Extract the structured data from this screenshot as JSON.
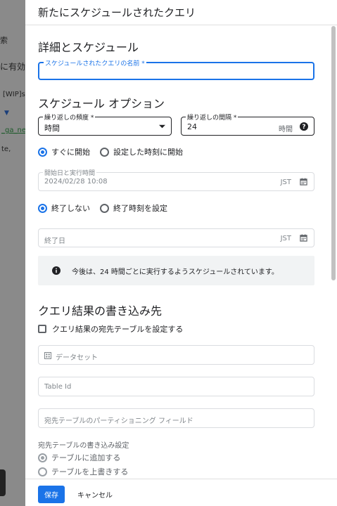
{
  "background": {
    "fragment_search": "索",
    "fragment_enabled": "に有効",
    "fragment_wip": "[WIP]si",
    "fragment_link": "_ga_new",
    "fragment_text": "te,"
  },
  "panel": {
    "title": "新たにスケジュールされたクエリ"
  },
  "details": {
    "heading": "詳細とスケジュール",
    "name_label": "スケジュールされたクエリの名前 *",
    "name_value": ""
  },
  "schedule": {
    "heading": "スケジュール オプション",
    "frequency_label": "繰り返しの頻度 *",
    "frequency_value": "時間",
    "interval_label": "繰り返しの間隔 *",
    "interval_value": "24",
    "interval_unit": "時間",
    "start_options": [
      "すぐに開始",
      "設定した時刻に開始"
    ],
    "start_selected": 0,
    "start_time_label": "開始日と実行時間",
    "start_time_value": "2024/02/28 10:08",
    "timezone": "JST",
    "end_options": [
      "終了しない",
      "終了時刻を設定"
    ],
    "end_selected": 0,
    "end_date_placeholder": "終了日",
    "end_timezone": "JST",
    "info_text": "今後は、24 時間ごとに実行するようスケジュールされています。"
  },
  "destination": {
    "heading": "クエリ結果の書き込み先",
    "checkbox_label": "クエリ結果の宛先テーブルを設定する",
    "dataset_placeholder": "データセット",
    "table_placeholder": "Table Id",
    "partition_placeholder": "宛先テーブルのパーティショニング フィールド",
    "write_setting_label": "宛先テーブルの書き込み設定",
    "write_options": [
      "テーブルに追加する",
      "テーブルを上書きする"
    ],
    "write_selected": 0
  },
  "footer": {
    "save_label": "保存",
    "cancel_label": "キャンセル"
  },
  "colors": {
    "accent": "#1a73e8",
    "info_bg": "#f1f3f4"
  }
}
